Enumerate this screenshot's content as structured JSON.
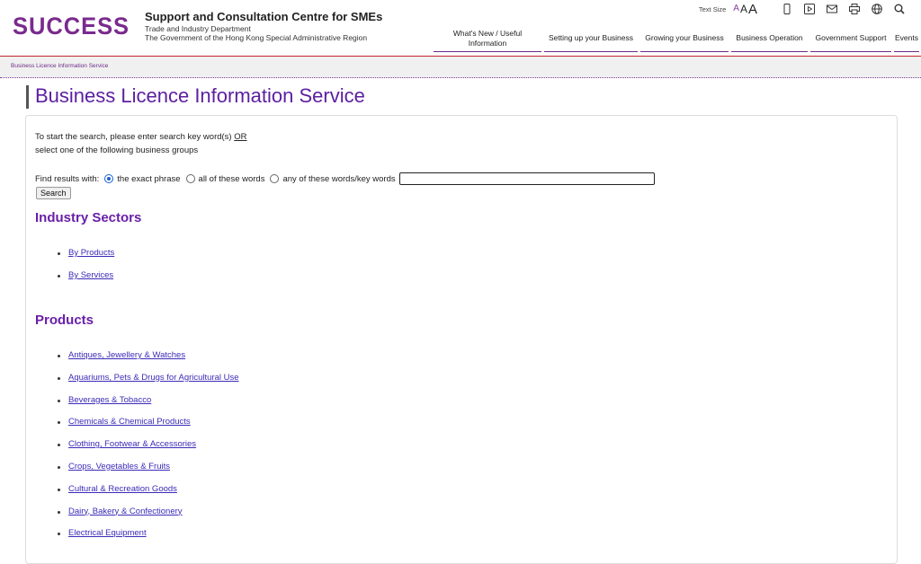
{
  "header": {
    "logo_text": "SUCCESS",
    "org_title": "Support and Consultation Centre for SMEs",
    "org_sub1": "Trade and Industry Department",
    "org_sub2": "The Government of the Hong Kong Special Administrative Region",
    "text_size_label": "Text Size",
    "text_size_small": "A",
    "text_size_medium": "A",
    "text_size_large": "A",
    "nav": [
      {
        "line1": "What's New / Useful",
        "line2": "Information"
      },
      {
        "line1": "Setting up your Business",
        "line2": ""
      },
      {
        "line1": "Growing your Business",
        "line2": ""
      },
      {
        "line1": "Business Operation",
        "line2": ""
      },
      {
        "line1": "Government Support",
        "line2": ""
      },
      {
        "line1": "Events",
        "line2": ""
      }
    ]
  },
  "breadcrumb": "Business Licence Information Service",
  "page_title": "Business Licence Information Service",
  "search": {
    "intro_line1": "To start the search, please enter search key word(s)",
    "intro_or": "OR",
    "intro_line2": "select one of the following business groups",
    "find_label": "Find results with:",
    "opt_exact": "the exact phrase",
    "opt_all": "all of these words",
    "opt_any": "any of these words/key words",
    "input_value": "",
    "button": "Search"
  },
  "industry": {
    "heading": "Industry Sectors",
    "items": [
      "By Products",
      "By Services"
    ]
  },
  "products": {
    "heading": "Products",
    "items": [
      "Antiques, Jewellery & Watches",
      "Aquariums, Pets & Drugs for Agricultural Use",
      "Beverages & Tobacco",
      "Chemicals & Chemical Products",
      "Clothing, Footwear & Accessories",
      "Crops, Vegetables & Fruits",
      "Cultural & Recreation Goods",
      "Dairy, Bakery & Confectionery",
      "Electrical Equipment"
    ]
  },
  "colors": {
    "accent": "#6a1fa8",
    "red_rule": "#c2272d",
    "link": "#3b2bb8"
  }
}
